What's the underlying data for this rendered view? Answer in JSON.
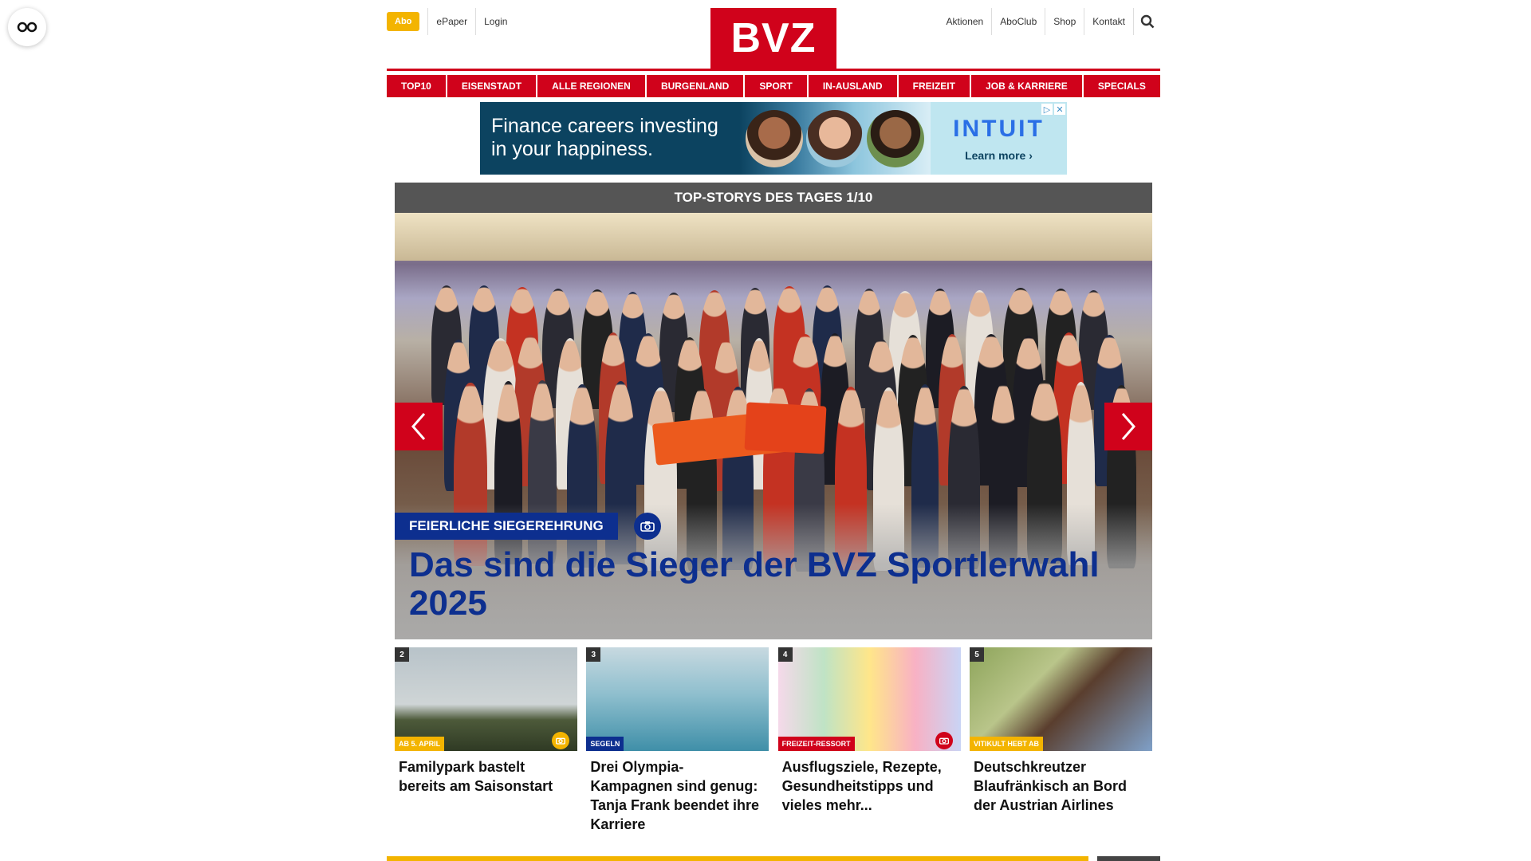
{
  "util": {
    "abo": "Abo",
    "left_links": [
      "ePaper",
      "Login"
    ],
    "right_links": [
      "Aktionen",
      "AboClub",
      "Shop",
      "Kontakt"
    ]
  },
  "logo": "BVZ",
  "nav": [
    "TOP10",
    "EISENSTADT",
    "ALLE REGIONEN",
    "BURGENLAND",
    "SPORT",
    "IN-AUSLAND",
    "FREIZEIT",
    "JOB & KARRIERE",
    "SPECIALS"
  ],
  "ad": {
    "headline": "Finance careers investing in your happiness.",
    "brand": "INTUIT",
    "cta": "Learn more ›"
  },
  "topstories": {
    "header": "TOP-STORYS DES TAGES 1/10",
    "hero": {
      "kicker": "FEIERLICHE SIEGEREHRUNG",
      "title": "Das sind die Sieger der BVZ Sportlerwahl 2025"
    }
  },
  "teasers": [
    {
      "num": "2",
      "tag": "AB 5. APRIL",
      "tag_color": "#f3b400",
      "title": "Familypark bastelt bereits am Saisonstart",
      "camera": true,
      "camera_color": "#f3b400"
    },
    {
      "num": "3",
      "tag": "SEGELN",
      "tag_color": "#0d2f8f",
      "title": "Drei Olympia-Kampagnen sind genug: Tanja Frank beendet ihre Karriere",
      "camera": false
    },
    {
      "num": "4",
      "tag": "FREIZEIT-RESSORT",
      "tag_color": "#d0021b",
      "title": "Ausflugsziele, Rezepte, Gesundheitstipps und vieles mehr...",
      "camera": true,
      "camera_color": "#d0021b"
    },
    {
      "num": "5",
      "tag": "VITIKULT HEBT AB",
      "tag_color": "#f3b400",
      "title": "Deutschkreutzer Blaufränkisch an Bord der Austrian Airlines",
      "camera": false
    }
  ],
  "colors": {
    "brand_red": "#d0021b",
    "accent_yellow": "#f3b400",
    "kicker_blue": "#0d2f8f"
  }
}
